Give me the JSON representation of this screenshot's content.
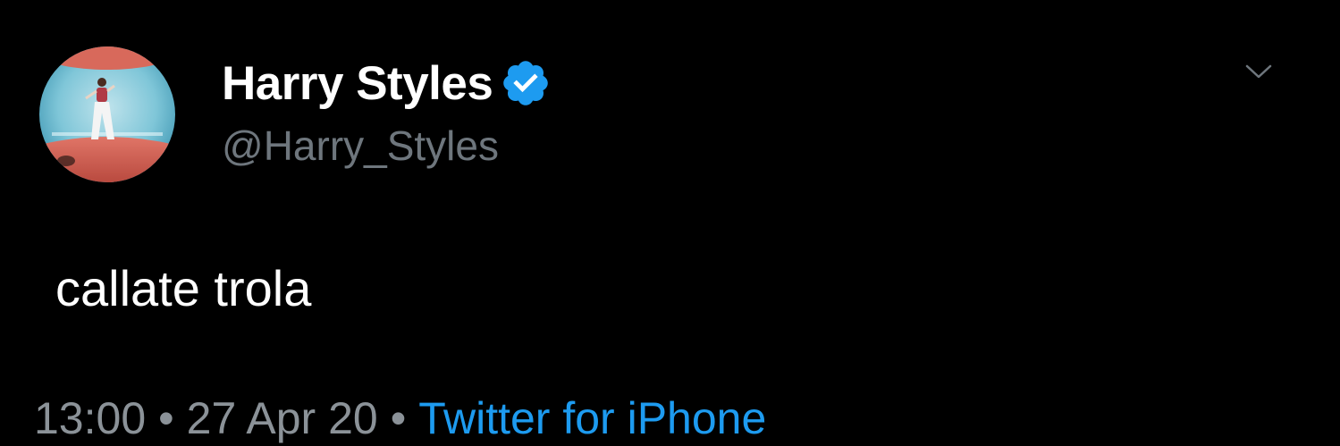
{
  "tweet": {
    "author": {
      "display_name": "Harry Styles",
      "handle": "@Harry_Styles",
      "verified": true
    },
    "text": "callate trola",
    "time": "13:00",
    "date": "27 Apr 20",
    "separator": "•",
    "source": "Twitter for iPhone"
  },
  "icons": {
    "verified": "verified-badge-icon",
    "menu": "chevron-down-icon"
  },
  "colors": {
    "background": "#000000",
    "text_primary": "#ffffff",
    "text_secondary": "#6e767d",
    "link": "#1d9bf0",
    "verified": "#1d9bf0"
  }
}
